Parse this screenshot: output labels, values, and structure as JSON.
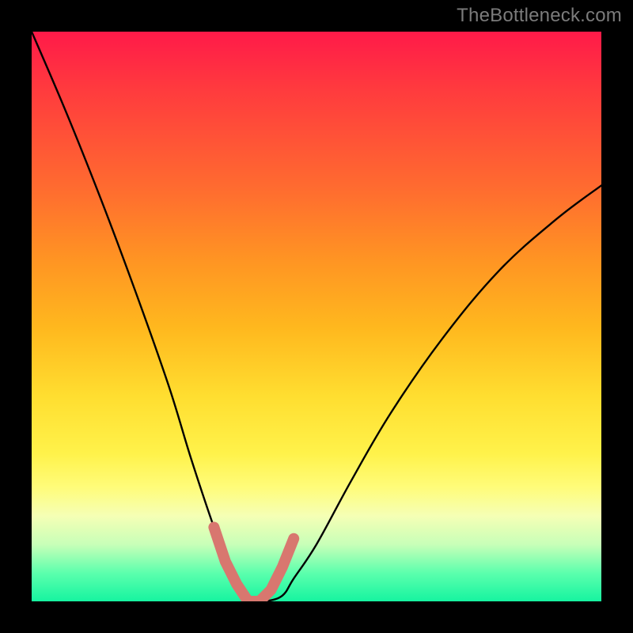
{
  "watermark": {
    "text": "TheBottleneck.com"
  },
  "chart_data": {
    "type": "line",
    "title": "",
    "xlabel": "",
    "ylabel": "",
    "xlim": [
      0,
      100
    ],
    "ylim": [
      0,
      100
    ],
    "grid": false,
    "series": [
      {
        "name": "bottleneck-curve",
        "x": [
          0,
          6,
          12,
          18,
          24,
          28,
          32,
          35,
          37,
          39,
          41,
          44,
          46,
          50,
          56,
          63,
          72,
          82,
          92,
          100
        ],
        "values": [
          100,
          86,
          71,
          55,
          38,
          25,
          13,
          5,
          1,
          0,
          0,
          1,
          4,
          10,
          21,
          33,
          46,
          58,
          67,
          73
        ]
      },
      {
        "name": "trough-highlight",
        "x": [
          32,
          34,
          36,
          38,
          40,
          42,
          44,
          46
        ],
        "values": [
          13,
          7,
          3,
          0,
          0,
          2,
          6,
          11
        ]
      }
    ],
    "colors": {
      "curve": "#000000",
      "highlight": "#d8776f"
    }
  }
}
